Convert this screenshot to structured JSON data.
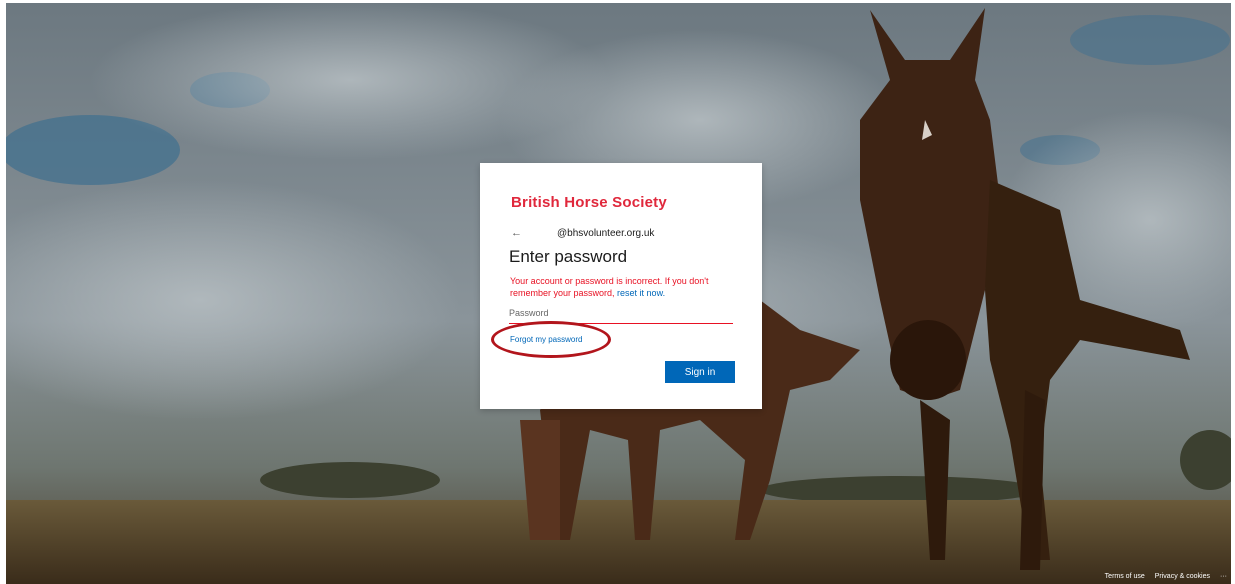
{
  "card": {
    "logo_text": "British Horse Society",
    "identity": "@bhsvolunteer.org.uk",
    "back_arrow": "←",
    "title": "Enter password",
    "error_text": "Your account or password is incorrect. If you don't remember your password, ",
    "error_link": "reset it now.",
    "password_placeholder": "Password",
    "forgot_link": "Forgot my password",
    "signin_label": "Sign in"
  },
  "footer": {
    "terms": "Terms of use",
    "privacy": "Privacy & cookies",
    "more": "···"
  },
  "colors": {
    "accent": "#0067b8",
    "error": "#e81123",
    "brand": "#e0283c",
    "annotation": "#b2151c"
  }
}
